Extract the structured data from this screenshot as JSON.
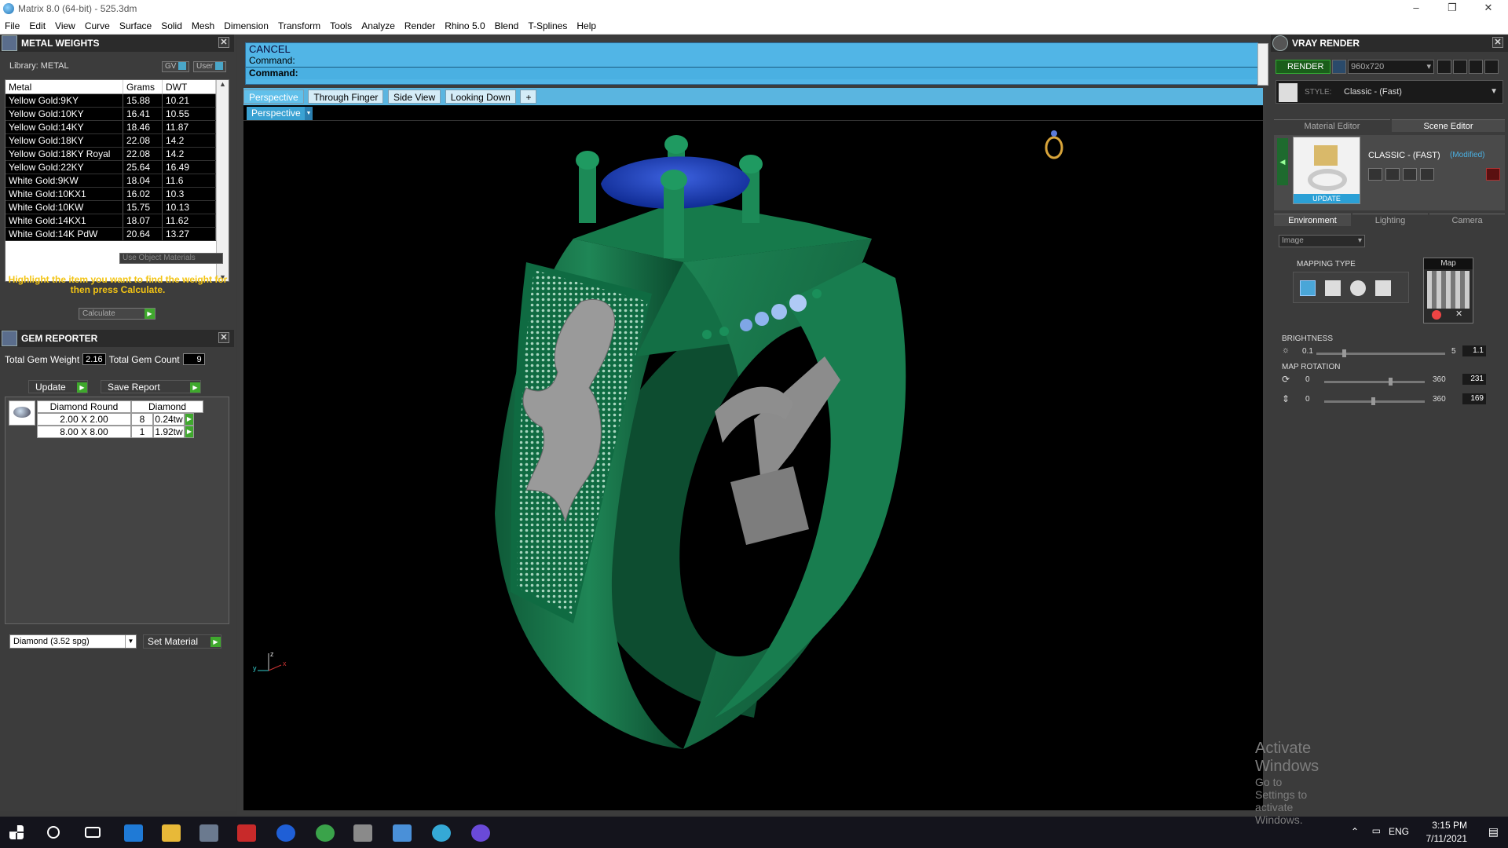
{
  "window": {
    "title": "Matrix 8.0 (64-bit) - 525.3dm",
    "minimize": "–",
    "maximize": "❐",
    "close": "✕"
  },
  "menu": [
    "File",
    "Edit",
    "View",
    "Curve",
    "Surface",
    "Solid",
    "Mesh",
    "Dimension",
    "Transform",
    "Tools",
    "Analyze",
    "Render",
    "Rhino 5.0",
    "Blend",
    "T-Splines",
    "Help"
  ],
  "metal_weights": {
    "title": "METAL WEIGHTS",
    "library_label": "Library: METAL",
    "gv_label": "GV",
    "user_label": "User",
    "columns": [
      "Metal",
      "Grams",
      "DWT"
    ],
    "rows": [
      [
        "Yellow Gold:9KY",
        "15.88",
        "10.21"
      ],
      [
        "Yellow Gold:10KY",
        "16.41",
        "10.55"
      ],
      [
        "Yellow Gold:14KY",
        "18.46",
        "11.87"
      ],
      [
        "Yellow Gold:18KY",
        "22.08",
        "14.2"
      ],
      [
        "Yellow Gold:18KY Royal",
        "22.08",
        "14.2"
      ],
      [
        "Yellow Gold:22KY",
        "25.64",
        "16.49"
      ],
      [
        "White Gold:9KW",
        "18.04",
        "11.6"
      ],
      [
        "White Gold:10KX1",
        "16.02",
        "10.3"
      ],
      [
        "White Gold:10KW",
        "15.75",
        "10.13"
      ],
      [
        "White Gold:14KX1",
        "18.07",
        "11.62"
      ],
      [
        "White Gold:14K PdW",
        "20.64",
        "13.27"
      ]
    ],
    "use_object_materials": "Use Object Materials",
    "hint": "Highlight the item you want to find the weight for then press Calculate.",
    "calculate": "Calculate"
  },
  "gem_reporter": {
    "title": "GEM REPORTER",
    "total_weight_label": "Total Gem Weight",
    "total_weight": "2.16",
    "total_count_label": "Total Gem Count",
    "total_count": "9",
    "update": "Update",
    "save_report": "Save Report",
    "columns": [
      "Diamond Round",
      "Diamond"
    ],
    "rows": [
      {
        "size": "2.00 X 2.00",
        "count": "8",
        "weight": "0.24tw"
      },
      {
        "size": "8.00 X 8.00",
        "count": "1",
        "weight": "1.92tw"
      }
    ],
    "material_select": "Diamond    (3.52 spg)",
    "set_material": "Set Material"
  },
  "command": {
    "line1": "CANCEL",
    "line2": "Command:",
    "line3": "Command:"
  },
  "view_tabs": [
    "Perspective",
    "Through Finger",
    "Side View",
    "Looking Down",
    "+"
  ],
  "viewport_label": "Perspective",
  "axis": {
    "z": "z",
    "y": "y",
    "x": "x"
  },
  "watermark": {
    "line1": "Activate Windows",
    "line2": "Go to Settings to activate Windows."
  },
  "vray": {
    "title": "VRAY RENDER",
    "render_btn": "RENDER",
    "resolution": "960x720",
    "style_label": "STYLE:",
    "style_value": "Classic - (Fast)",
    "tabs": [
      "Material Editor",
      "Scene Editor"
    ],
    "preset_name": "CLASSIC - (FAST)",
    "preset_modified": "(Modified)",
    "update": "UPDATE",
    "env_tabs": [
      "Environment",
      "Lighting",
      "Camera"
    ],
    "env_type": "Image",
    "map_label": "Map",
    "mapping_type": "MAPPING TYPE",
    "brightness_label": "BRIGHTNESS",
    "brightness": {
      "min": "0.1",
      "max": "5",
      "value": "1.1",
      "level": 0.2
    },
    "map_rotation_label": "MAP ROTATION",
    "rotation1": {
      "min": "0",
      "max": "360",
      "value": "231",
      "level": 0.64
    },
    "rotation2": {
      "min": "0",
      "max": "360",
      "value": "169",
      "level": 0.47
    }
  },
  "taskbar": {
    "time": "3:15 PM",
    "date": "7/11/2021",
    "lang": "ENG"
  },
  "colors": {
    "ring": "#1f8656",
    "stone": "#1e3fb4",
    "panel": "#3b3b3b",
    "cmd": "#51b5e6",
    "hint": "#f3c414"
  }
}
